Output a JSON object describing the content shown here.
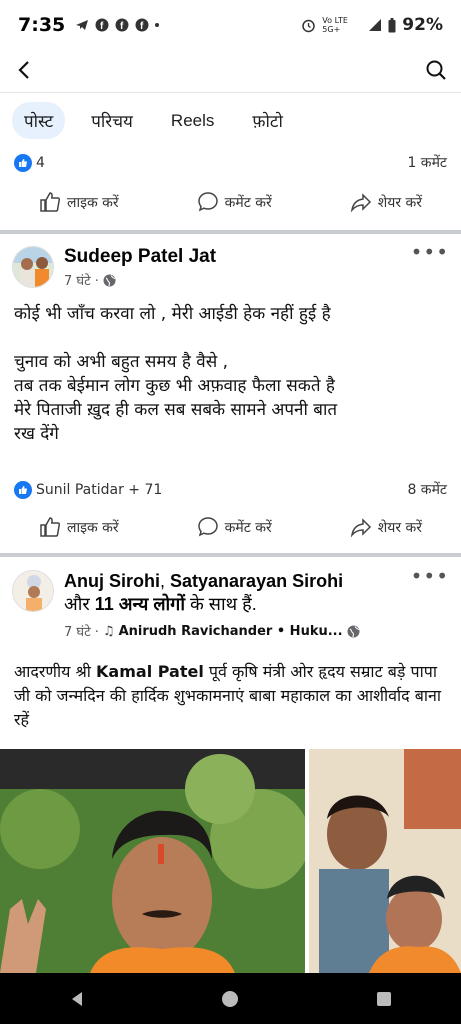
{
  "status_bar": {
    "time": "7:35",
    "icons": [
      "telegram-icon",
      "facebook-icon",
      "facebook-icon",
      "facebook-icon",
      "dot-icon"
    ],
    "net_label": "Vo LTE 5G+",
    "battery": "92%"
  },
  "tabs": [
    {
      "label": "पोस्ट",
      "active": true
    },
    {
      "label": "परिचय",
      "active": false
    },
    {
      "label": "Reels",
      "active": false
    },
    {
      "label": "फ़ोटो",
      "active": false
    }
  ],
  "prev_post": {
    "likes": "4",
    "comments": "1 कमेंट",
    "actions": {
      "like": "लाइक करें",
      "comment": "कमेंट करें",
      "share": "शेयर करें"
    }
  },
  "post1": {
    "author": "Sudeep Patel Jat",
    "time": "7 घंटे ·",
    "lines": [
      "कोई भी जाँच करवा लो , मेरी आईडी हेक नहीं हुई है",
      "चुनाव को अभी बहुत समय है वैसे ,",
      "तब तक बेईमान लोग कुछ भी अफ़वाह फैला सकते है",
      "मेरे पिताजी ख़ुद ही कल सब सबके सामने अपनी बात",
      "रख देंगे"
    ],
    "reactions": "Sunil Patidar + 71",
    "comments": "8 कमेंट",
    "actions": {
      "like": "लाइक करें",
      "comment": "कमेंट करें",
      "share": "शेयर करें"
    }
  },
  "post2": {
    "author_a": "Anuj Sirohi",
    "sep": ", ",
    "author_b": "Satyanarayan Sirohi",
    "with_prefix": "और ",
    "with_count": "11 अन्य लोगों",
    "with_suffix": " के साथ हैं.",
    "time": "7 घंटे ·",
    "music": "Anirudh Ravichander • Huku...",
    "text_prefix": "आदरणीय श्री ",
    "text_bold": "Kamal Patel",
    "text_rest": " पूर्व कृषि मंत्री ओर हृदय सम्राट बड़े पापा जी को जन्मदिन की हार्दिक शुभकामनाएं बाबा महाकाल का आशीर्वाद बाना रहें"
  },
  "colors": {
    "accent": "#1877f2",
    "divider": "#c9ccd1",
    "active_tab_bg": "#e7f0fd"
  }
}
